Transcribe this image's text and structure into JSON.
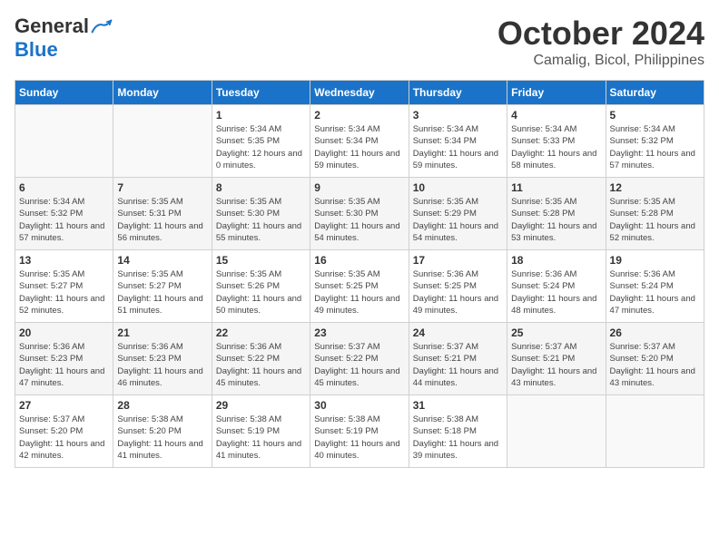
{
  "header": {
    "logo_general": "General",
    "logo_blue": "Blue",
    "month": "October 2024",
    "location": "Camalig, Bicol, Philippines"
  },
  "days_of_week": [
    "Sunday",
    "Monday",
    "Tuesday",
    "Wednesday",
    "Thursday",
    "Friday",
    "Saturday"
  ],
  "weeks": [
    [
      {
        "day": "",
        "sunrise": "",
        "sunset": "",
        "daylight": ""
      },
      {
        "day": "",
        "sunrise": "",
        "sunset": "",
        "daylight": ""
      },
      {
        "day": "1",
        "sunrise": "Sunrise: 5:34 AM",
        "sunset": "Sunset: 5:35 PM",
        "daylight": "Daylight: 12 hours and 0 minutes."
      },
      {
        "day": "2",
        "sunrise": "Sunrise: 5:34 AM",
        "sunset": "Sunset: 5:34 PM",
        "daylight": "Daylight: 11 hours and 59 minutes."
      },
      {
        "day": "3",
        "sunrise": "Sunrise: 5:34 AM",
        "sunset": "Sunset: 5:34 PM",
        "daylight": "Daylight: 11 hours and 59 minutes."
      },
      {
        "day": "4",
        "sunrise": "Sunrise: 5:34 AM",
        "sunset": "Sunset: 5:33 PM",
        "daylight": "Daylight: 11 hours and 58 minutes."
      },
      {
        "day": "5",
        "sunrise": "Sunrise: 5:34 AM",
        "sunset": "Sunset: 5:32 PM",
        "daylight": "Daylight: 11 hours and 57 minutes."
      }
    ],
    [
      {
        "day": "6",
        "sunrise": "Sunrise: 5:34 AM",
        "sunset": "Sunset: 5:32 PM",
        "daylight": "Daylight: 11 hours and 57 minutes."
      },
      {
        "day": "7",
        "sunrise": "Sunrise: 5:35 AM",
        "sunset": "Sunset: 5:31 PM",
        "daylight": "Daylight: 11 hours and 56 minutes."
      },
      {
        "day": "8",
        "sunrise": "Sunrise: 5:35 AM",
        "sunset": "Sunset: 5:30 PM",
        "daylight": "Daylight: 11 hours and 55 minutes."
      },
      {
        "day": "9",
        "sunrise": "Sunrise: 5:35 AM",
        "sunset": "Sunset: 5:30 PM",
        "daylight": "Daylight: 11 hours and 54 minutes."
      },
      {
        "day": "10",
        "sunrise": "Sunrise: 5:35 AM",
        "sunset": "Sunset: 5:29 PM",
        "daylight": "Daylight: 11 hours and 54 minutes."
      },
      {
        "day": "11",
        "sunrise": "Sunrise: 5:35 AM",
        "sunset": "Sunset: 5:28 PM",
        "daylight": "Daylight: 11 hours and 53 minutes."
      },
      {
        "day": "12",
        "sunrise": "Sunrise: 5:35 AM",
        "sunset": "Sunset: 5:28 PM",
        "daylight": "Daylight: 11 hours and 52 minutes."
      }
    ],
    [
      {
        "day": "13",
        "sunrise": "Sunrise: 5:35 AM",
        "sunset": "Sunset: 5:27 PM",
        "daylight": "Daylight: 11 hours and 52 minutes."
      },
      {
        "day": "14",
        "sunrise": "Sunrise: 5:35 AM",
        "sunset": "Sunset: 5:27 PM",
        "daylight": "Daylight: 11 hours and 51 minutes."
      },
      {
        "day": "15",
        "sunrise": "Sunrise: 5:35 AM",
        "sunset": "Sunset: 5:26 PM",
        "daylight": "Daylight: 11 hours and 50 minutes."
      },
      {
        "day": "16",
        "sunrise": "Sunrise: 5:35 AM",
        "sunset": "Sunset: 5:25 PM",
        "daylight": "Daylight: 11 hours and 49 minutes."
      },
      {
        "day": "17",
        "sunrise": "Sunrise: 5:36 AM",
        "sunset": "Sunset: 5:25 PM",
        "daylight": "Daylight: 11 hours and 49 minutes."
      },
      {
        "day": "18",
        "sunrise": "Sunrise: 5:36 AM",
        "sunset": "Sunset: 5:24 PM",
        "daylight": "Daylight: 11 hours and 48 minutes."
      },
      {
        "day": "19",
        "sunrise": "Sunrise: 5:36 AM",
        "sunset": "Sunset: 5:24 PM",
        "daylight": "Daylight: 11 hours and 47 minutes."
      }
    ],
    [
      {
        "day": "20",
        "sunrise": "Sunrise: 5:36 AM",
        "sunset": "Sunset: 5:23 PM",
        "daylight": "Daylight: 11 hours and 47 minutes."
      },
      {
        "day": "21",
        "sunrise": "Sunrise: 5:36 AM",
        "sunset": "Sunset: 5:23 PM",
        "daylight": "Daylight: 11 hours and 46 minutes."
      },
      {
        "day": "22",
        "sunrise": "Sunrise: 5:36 AM",
        "sunset": "Sunset: 5:22 PM",
        "daylight": "Daylight: 11 hours and 45 minutes."
      },
      {
        "day": "23",
        "sunrise": "Sunrise: 5:37 AM",
        "sunset": "Sunset: 5:22 PM",
        "daylight": "Daylight: 11 hours and 45 minutes."
      },
      {
        "day": "24",
        "sunrise": "Sunrise: 5:37 AM",
        "sunset": "Sunset: 5:21 PM",
        "daylight": "Daylight: 11 hours and 44 minutes."
      },
      {
        "day": "25",
        "sunrise": "Sunrise: 5:37 AM",
        "sunset": "Sunset: 5:21 PM",
        "daylight": "Daylight: 11 hours and 43 minutes."
      },
      {
        "day": "26",
        "sunrise": "Sunrise: 5:37 AM",
        "sunset": "Sunset: 5:20 PM",
        "daylight": "Daylight: 11 hours and 43 minutes."
      }
    ],
    [
      {
        "day": "27",
        "sunrise": "Sunrise: 5:37 AM",
        "sunset": "Sunset: 5:20 PM",
        "daylight": "Daylight: 11 hours and 42 minutes."
      },
      {
        "day": "28",
        "sunrise": "Sunrise: 5:38 AM",
        "sunset": "Sunset: 5:20 PM",
        "daylight": "Daylight: 11 hours and 41 minutes."
      },
      {
        "day": "29",
        "sunrise": "Sunrise: 5:38 AM",
        "sunset": "Sunset: 5:19 PM",
        "daylight": "Daylight: 11 hours and 41 minutes."
      },
      {
        "day": "30",
        "sunrise": "Sunrise: 5:38 AM",
        "sunset": "Sunset: 5:19 PM",
        "daylight": "Daylight: 11 hours and 40 minutes."
      },
      {
        "day": "31",
        "sunrise": "Sunrise: 5:38 AM",
        "sunset": "Sunset: 5:18 PM",
        "daylight": "Daylight: 11 hours and 39 minutes."
      },
      {
        "day": "",
        "sunrise": "",
        "sunset": "",
        "daylight": ""
      },
      {
        "day": "",
        "sunrise": "",
        "sunset": "",
        "daylight": ""
      }
    ]
  ]
}
